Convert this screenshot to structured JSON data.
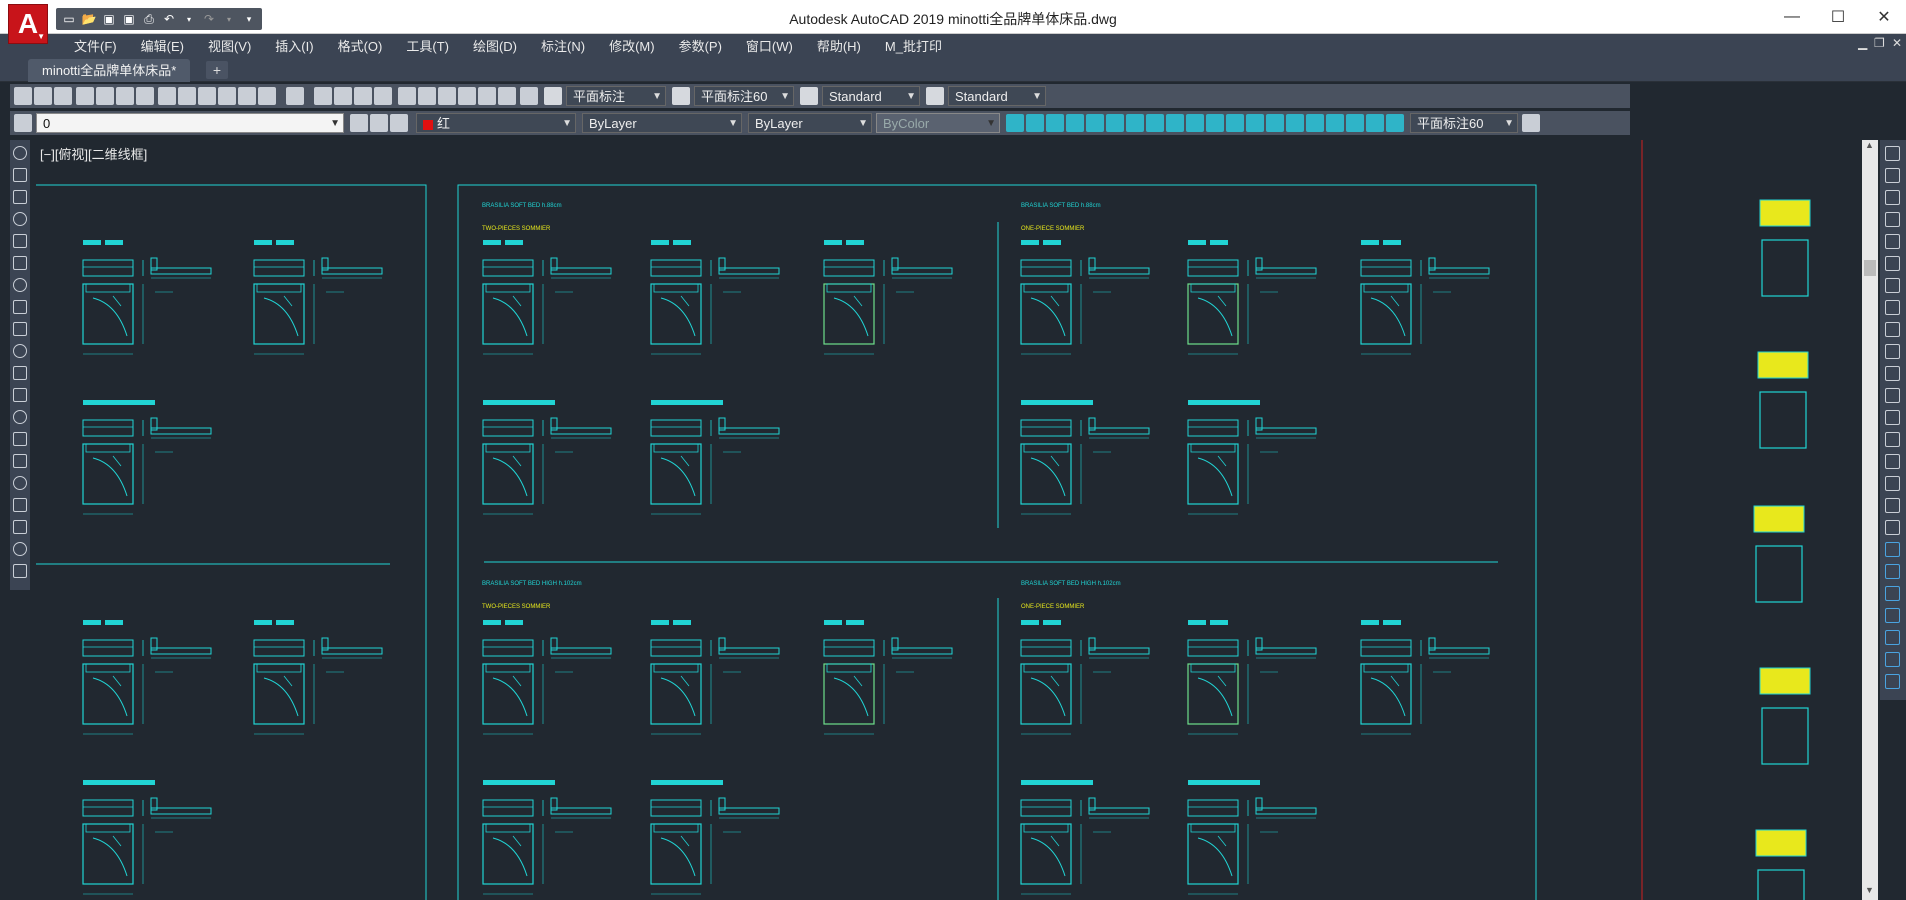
{
  "window": {
    "app_icon_letter": "A",
    "title": "Autodesk AutoCAD 2019      minotti全品牌单体床品.dwg",
    "minimize": "—",
    "maximize": "☐",
    "close": "✕"
  },
  "menu": [
    "文件(F)",
    "编辑(E)",
    "视图(V)",
    "插入(I)",
    "格式(O)",
    "工具(T)",
    "绘图(D)",
    "标注(N)",
    "修改(M)",
    "参数(P)",
    "窗口(W)",
    "帮助(H)",
    "M_批打印"
  ],
  "tabs": {
    "doc_tab": "minotti全品牌单体床品*",
    "add_tab": "+"
  },
  "toolbar1": {
    "text_style": "平面标注",
    "dim_style": "平面标注60",
    "table_style": "Standard",
    "mleader_style": "Standard"
  },
  "toolbar2": {
    "layer": "0",
    "color": "红",
    "linetype": "ByLayer",
    "lineweight": "ByLayer",
    "plotstyle": "ByColor",
    "dim_style": "平面标注60"
  },
  "viewport": {
    "label": "[−][俯视][二维线框]"
  },
  "drawing_text": {
    "header1": "BRASILIA SOFT BED  h.88cm",
    "header2": "BRASILIA SOFT BED  h.88cm",
    "header3": "BRASILIA SOFT BED HIGH  h.102cm",
    "header4": "BRASILIA SOFT BED HIGH  h.102cm",
    "sub1": "TWO-PIECES SOMMIER",
    "sub2": "ONE-PIECE SOMMIER",
    "sub3": "TWO-PIECES SOMMIER",
    "sub4": "ONE-PIECE SOMMIER"
  },
  "colors": {
    "canvas": "#212830",
    "cad_cyan": "#21d4d4",
    "cad_yellow": "#e8e81c",
    "cad_green": "#6ee08a",
    "cursor_red": "#d02020",
    "bar": "#3b4453"
  }
}
